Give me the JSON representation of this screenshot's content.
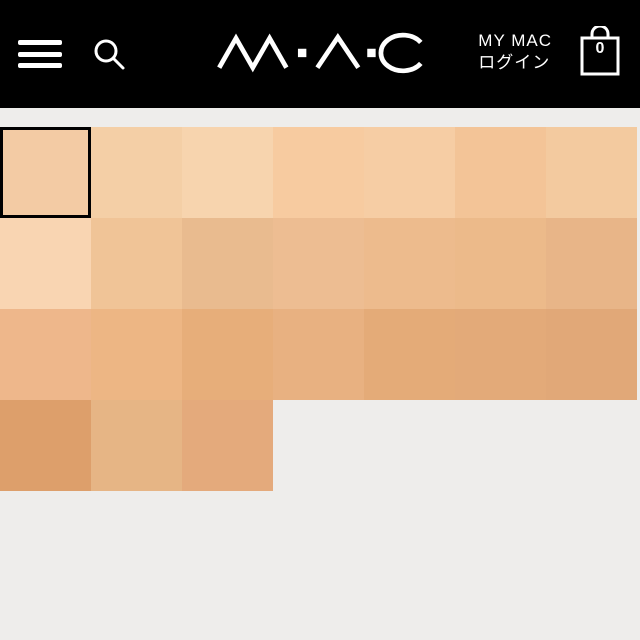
{
  "header": {
    "account_line1": "MY MAC",
    "account_line2": "ログイン",
    "bag_count": "0"
  },
  "swatches": {
    "selected_index": 0,
    "rows": [
      [
        {
          "color": "#f3cba4"
        },
        {
          "color": "#f4cfa6"
        },
        {
          "color": "#f7d4ae"
        },
        {
          "color": "#f7cba0"
        },
        {
          "color": "#f6cda4"
        },
        {
          "color": "#f3c497"
        },
        {
          "color": "#f3ca9f"
        }
      ],
      [
        {
          "color": "#f9d5b2"
        },
        {
          "color": "#f0c497"
        },
        {
          "color": "#e9bb8f"
        },
        {
          "color": "#edbd92"
        },
        {
          "color": "#edbb8d"
        },
        {
          "color": "#ecba8a"
        },
        {
          "color": "#e8b588"
        }
      ],
      [
        {
          "color": "#eeb78b"
        },
        {
          "color": "#edb684"
        },
        {
          "color": "#e7ae7a"
        },
        {
          "color": "#e8b181"
        },
        {
          "color": "#e4ab78"
        },
        {
          "color": "#e3aa79"
        },
        {
          "color": "#e1a878"
        }
      ],
      [
        {
          "color": "#dd9f6b"
        },
        {
          "color": "#e6b585"
        },
        {
          "color": "#e4aa7c"
        },
        {
          "empty": true
        },
        {
          "empty": true
        },
        {
          "empty": true
        },
        {
          "empty": true
        }
      ]
    ]
  }
}
